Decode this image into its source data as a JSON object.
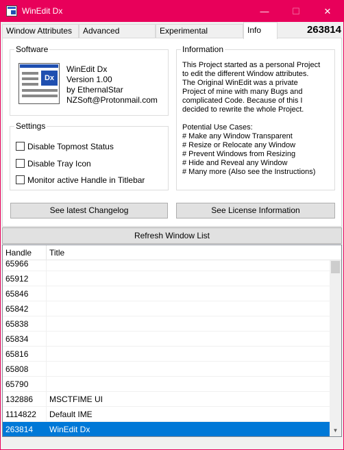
{
  "window": {
    "title": "WinEdit Dx",
    "accent_color": "#e8005a",
    "controls": {
      "minimize": "—",
      "maximize": "☐",
      "close": "✕"
    }
  },
  "tabs": [
    {
      "label": "Window Attributes"
    },
    {
      "label": "Advanced Features"
    },
    {
      "label": "Experimental Features"
    },
    {
      "label": "Info",
      "active": true
    }
  ],
  "tab_counter": "263814",
  "software": {
    "label": "Software",
    "icon": "app-logo-icon",
    "badge": "Dx",
    "lines": [
      "WinEdit Dx",
      "Version 1.00",
      "by EthernalStar",
      "NZSoft@Protonmail.com"
    ]
  },
  "information": {
    "label": "Information",
    "paragraph": [
      "This Project started as a personal Project",
      "to edit the different Window attributes.",
      "The Original WinEdit was a private",
      "Project of mine with many Bugs and",
      "complicated Code. Because of this I",
      "decided to rewrite the whole Project."
    ],
    "use_cases_title": "Potential Use Cases:",
    "use_cases": [
      "# Make any Window Transparent",
      "# Resize or Relocate any Window",
      "# Prevent Windows from Resizing",
      "# Hide and Reveal any Window",
      "# Many more (Also see the Instructions)"
    ]
  },
  "settings": {
    "label": "Settings",
    "options": [
      {
        "label": "Disable Topmost Status",
        "checked": false
      },
      {
        "label": "Disable Tray Icon",
        "checked": false
      },
      {
        "label": "Monitor active Handle in Titlebar",
        "checked": false
      }
    ]
  },
  "buttons": {
    "changelog": "See latest Changelog",
    "license": "See License Information",
    "refresh": "Refresh Window List"
  },
  "window_list": {
    "columns": [
      "Handle",
      "Title"
    ],
    "rows": [
      {
        "handle": "65966",
        "title": ""
      },
      {
        "handle": "65912",
        "title": ""
      },
      {
        "handle": "65846",
        "title": ""
      },
      {
        "handle": "65842",
        "title": ""
      },
      {
        "handle": "65838",
        "title": ""
      },
      {
        "handle": "65834",
        "title": ""
      },
      {
        "handle": "65816",
        "title": ""
      },
      {
        "handle": "65808",
        "title": ""
      },
      {
        "handle": "65790",
        "title": ""
      },
      {
        "handle": "132886",
        "title": "MSCTFIME UI"
      },
      {
        "handle": "1114822",
        "title": "Default IME"
      },
      {
        "handle": "263814",
        "title": "WinEdit Dx",
        "selected": true
      }
    ],
    "selection_color": "#0078d7",
    "scroll_up_icon": "▲",
    "scroll_down_icon": "▼"
  }
}
